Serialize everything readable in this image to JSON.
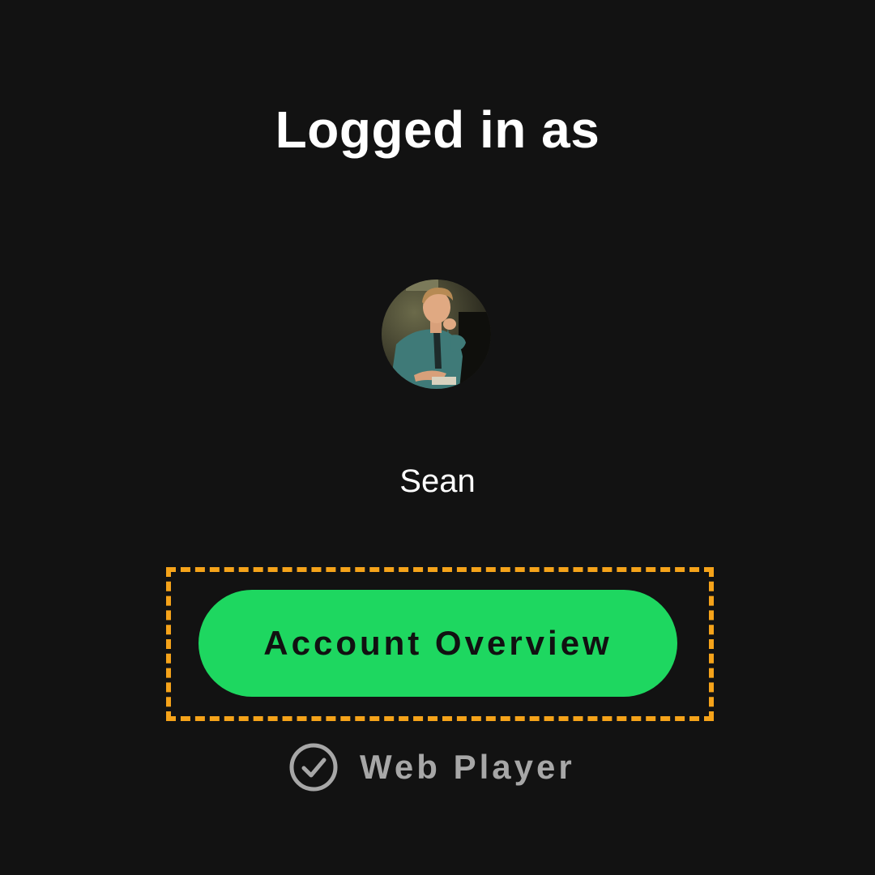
{
  "header": {
    "title": "Logged in as"
  },
  "profile": {
    "avatar_icon": "user-avatar",
    "name": "Sean"
  },
  "actions": {
    "account_overview_label": "Account Overview",
    "web_player_label": "Web Player",
    "web_player_icon": "check-circle-icon"
  },
  "colors": {
    "background": "#121212",
    "accent_green": "#1ed760",
    "highlight_orange": "#f5a31a",
    "secondary_text": "#a7a7a7"
  }
}
